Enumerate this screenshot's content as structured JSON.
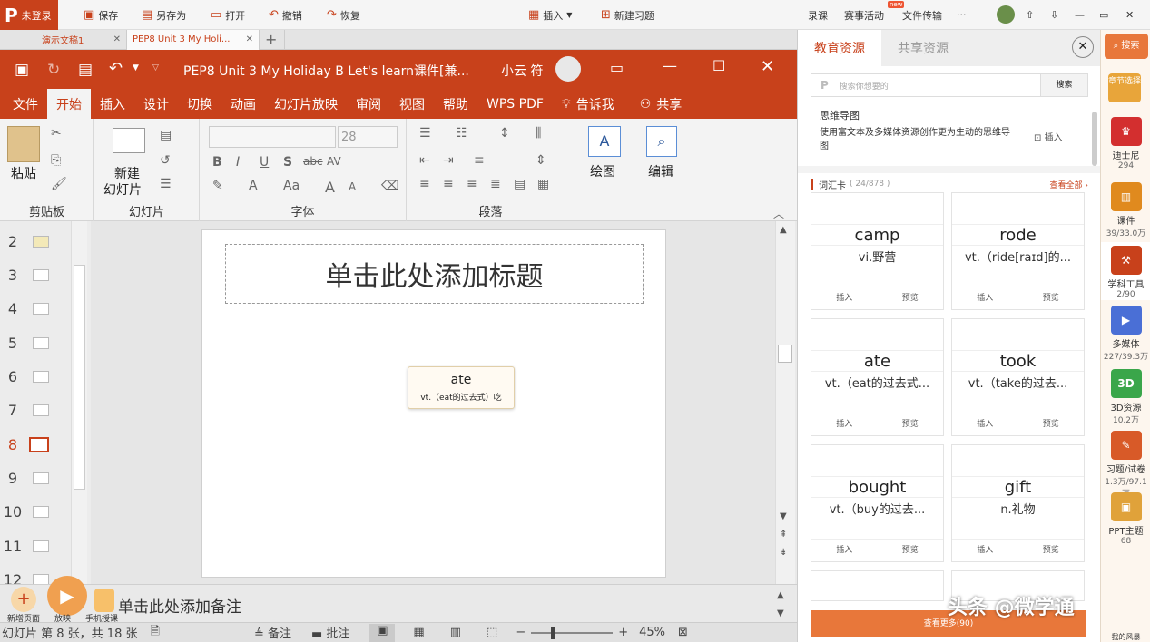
{
  "topbar": {
    "logo": "P",
    "login": "未登录",
    "save": "保存",
    "saveas": "另存为",
    "open": "打开",
    "undo": "撤销",
    "redo": "恢复",
    "insert": "插入",
    "new_exercise": "新建习题",
    "record": "录课",
    "contest": "赛事活动",
    "contest_badge": "new",
    "transfer": "文件传输",
    "more": "···"
  },
  "doctabs": [
    {
      "label": "演示文稿1"
    },
    {
      "label": "PEP8 Unit 3 My Holi..."
    }
  ],
  "window": {
    "title": "PEP8 Unit 3 My Holiday B Let's learn课件[兼...",
    "user": "小云 符"
  },
  "menu": [
    "文件",
    "开始",
    "插入",
    "设计",
    "切换",
    "动画",
    "幻灯片放映",
    "审阅",
    "视图",
    "帮助",
    "WPS PDF",
    "告诉我",
    "共享"
  ],
  "ribbon": {
    "paste": "粘贴",
    "clipboard": "剪贴板",
    "new_slide": "新建",
    "new_slide2": "幻灯片",
    "slides": "幻灯片",
    "font_size": "28",
    "font": "字体",
    "bold": "B",
    "italic": "I",
    "underline": "U",
    "shadow": "S",
    "strike": "abc",
    "spacing": "AV",
    "case": "Aa",
    "grow": "A",
    "shrink": "A",
    "paragraph": "段落",
    "draw": "绘图",
    "edit": "编辑"
  },
  "thumbs": [
    {
      "n": "2"
    },
    {
      "n": "3"
    },
    {
      "n": "4"
    },
    {
      "n": "5"
    },
    {
      "n": "6"
    },
    {
      "n": "7"
    },
    {
      "n": "8"
    },
    {
      "n": "9"
    },
    {
      "n": "10"
    },
    {
      "n": "11"
    },
    {
      "n": "12"
    }
  ],
  "slide": {
    "title_placeholder": "单击此处添加标题",
    "card_word": "ate",
    "card_def": "vt.（eat的过去式）吃"
  },
  "notes": {
    "placeholder": "单击此处添加备注",
    "new_page": "新增页面",
    "play": "放映",
    "mobile": "手机授课"
  },
  "status": {
    "slide_info": "幻灯片 第 8 张，共 18 张",
    "notes": "备注",
    "comments": "批注",
    "zoom": "45%"
  },
  "rpane": {
    "tab_edu": "教育资源",
    "tab_share": "共享资源",
    "search_placeholder": "搜索你想要的",
    "search_btn": "搜索",
    "mindmap_title": "思维导图",
    "mindmap_desc": "使用富文本及多媒体资源创作更为生动的思维导图",
    "insert": "插入",
    "vocab_title": "词汇卡",
    "vocab_count": "( 24/878 )",
    "view_all": "查看全部",
    "cards": [
      {
        "w": "camp",
        "d": "vi.野营"
      },
      {
        "w": "rode",
        "d": "vt.（ride[raɪd]的..."
      },
      {
        "w": "ate",
        "d": "vt.（eat的过去式..."
      },
      {
        "w": "took",
        "d": "vt.（take的过去..."
      },
      {
        "w": "bought",
        "d": "vt.（buy的过去..."
      },
      {
        "w": "gift",
        "d": "n.礼物"
      }
    ],
    "card_insert": "插入",
    "card_preview": "预览",
    "more": "查看更多(90)"
  },
  "sidebar": {
    "search": "搜索",
    "chapter": "章节选择",
    "items": [
      {
        "label": "迪士尼",
        "count": "294",
        "color": "#d32f2f"
      },
      {
        "label": "课件",
        "count": "39/33.0万",
        "color": "#e08a1e"
      },
      {
        "label": "学科工具",
        "count": "2/90",
        "color": "#c8411b"
      },
      {
        "label": "多媒体",
        "count": "227/39.3万",
        "color": "#4a6fd6"
      },
      {
        "label": "3D资源",
        "count": "10.2万",
        "color": "#3aa64a"
      },
      {
        "label": "习题/试卷",
        "count": "1.3万/97.1万",
        "color": "#d85a28"
      },
      {
        "label": "PPT主题",
        "count": "68",
        "color": "#e0a23a"
      }
    ],
    "bottom": "我的风暴"
  },
  "watermark": "头条 @微学通"
}
